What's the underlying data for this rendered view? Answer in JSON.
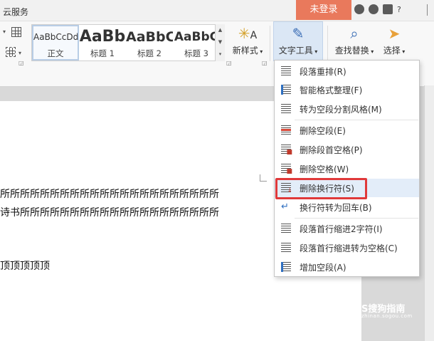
{
  "topbar": {
    "cloud_label": "云服务",
    "login_button": "未登录",
    "help_label": "?"
  },
  "ribbon": {
    "styles": [
      {
        "sample": "AaBbCcDd",
        "name": "正文"
      },
      {
        "sample": "AaBb",
        "name": "标题 1"
      },
      {
        "sample": "AaBbC",
        "name": "标题 2"
      },
      {
        "sample": "AaBbC",
        "name": "标题 3"
      }
    ],
    "new_style_label": "新样式",
    "text_tools_label": "文字工具",
    "find_replace_label": "查找替换",
    "select_label": "选择"
  },
  "document": {
    "lines": [
      "所所所所所所所所所所所所所所所所所所所所所所",
      "诗书所所所所所所所所所所所所所所所所所所所所",
      "顶顶顶顶顶"
    ]
  },
  "menu": {
    "items": [
      {
        "label": "段落重排(R)"
      },
      {
        "label": "智能格式整理(F)"
      },
      {
        "label": "转为空段分割风格(M)"
      },
      {
        "label": "删除空段(E)"
      },
      {
        "label": "删除段首空格(P)"
      },
      {
        "label": "删除空格(W)"
      },
      {
        "label": "删除换行符(S)"
      },
      {
        "label": "换行符转为回车(B)"
      },
      {
        "label": "段落首行缩进2字符(I)"
      },
      {
        "label": "段落首行缩进转为空格(C)"
      },
      {
        "label": "增加空段(A)"
      }
    ],
    "highlighted_index": 6
  },
  "watermark": {
    "main": "S搜狗指南",
    "sub": "zhinan.sogou.com"
  },
  "colors": {
    "login_bg": "#e9795c",
    "highlight_box": "#e0393a",
    "menu_hover": "#e3edf9"
  }
}
